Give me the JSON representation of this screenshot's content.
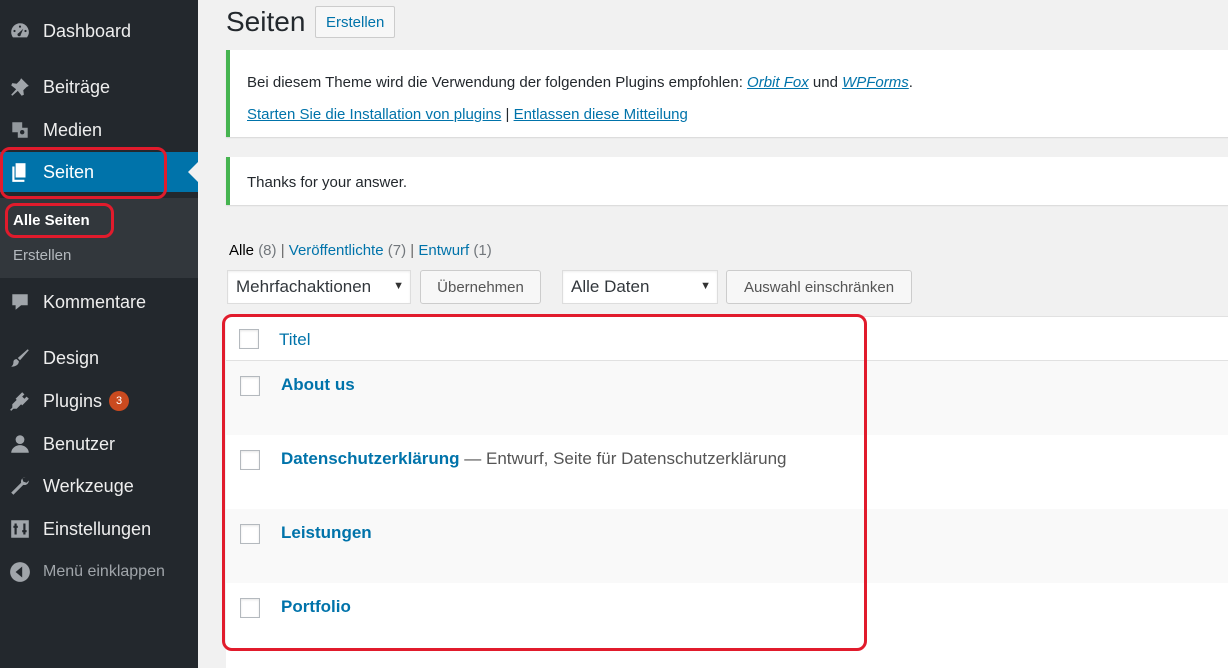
{
  "sidebar": {
    "items": [
      {
        "label": "Dashboard",
        "icon": "dashboard-icon"
      },
      {
        "label": "Beiträge",
        "icon": "pin-icon"
      },
      {
        "label": "Medien",
        "icon": "media-icon"
      },
      {
        "label": "Seiten",
        "icon": "page-icon"
      },
      {
        "label": "Kommentare",
        "icon": "comment-icon"
      },
      {
        "label": "Design",
        "icon": "brush-icon"
      },
      {
        "label": "Plugins",
        "icon": "plugin-icon",
        "badge": "3"
      },
      {
        "label": "Benutzer",
        "icon": "user-icon"
      },
      {
        "label": "Werkzeuge",
        "icon": "wrench-icon"
      },
      {
        "label": "Einstellungen",
        "icon": "settings-icon"
      },
      {
        "label": "Menü einklappen",
        "icon": "collapse-icon"
      }
    ],
    "submenu": [
      "Alle Seiten",
      "Erstellen"
    ]
  },
  "header": {
    "title": "Seiten",
    "add_new": "Erstellen"
  },
  "notice1": {
    "text": "Bei diesem Theme wird die Verwendung der folgenden Plugins empfohlen:",
    "plugin1": "Orbit Fox",
    "and": "und",
    "plugin2": "WPForms",
    "period": ".",
    "install_link": "Starten Sie die Installation von plugins",
    "sep": "|",
    "dismiss_link": "Entlassen diese Mitteilung"
  },
  "notice2": {
    "text": "Thanks for your answer."
  },
  "filters": {
    "all": "Alle",
    "all_count": "(8)",
    "published": "Veröffentlichte",
    "published_count": "(7)",
    "draft": "Entwurf",
    "draft_count": "(1)",
    "sep": "|"
  },
  "toolbar": {
    "bulk": "Mehrfachaktionen",
    "apply": "Übernehmen",
    "dates": "Alle Daten",
    "filter": "Auswahl einschränken"
  },
  "table": {
    "header": "Titel",
    "rows": [
      {
        "title": "About us",
        "state": ""
      },
      {
        "title": "Datenschutzerklärung",
        "state": " — Entwurf, Seite für Datenschutzerklärung"
      },
      {
        "title": "Leistungen",
        "state": ""
      },
      {
        "title": "Portfolio",
        "state": ""
      }
    ]
  },
  "colors": {
    "accent": "#0073aa",
    "sidebar": "#23282d",
    "highlight": "#e11b2c",
    "notice": "#46b450"
  }
}
